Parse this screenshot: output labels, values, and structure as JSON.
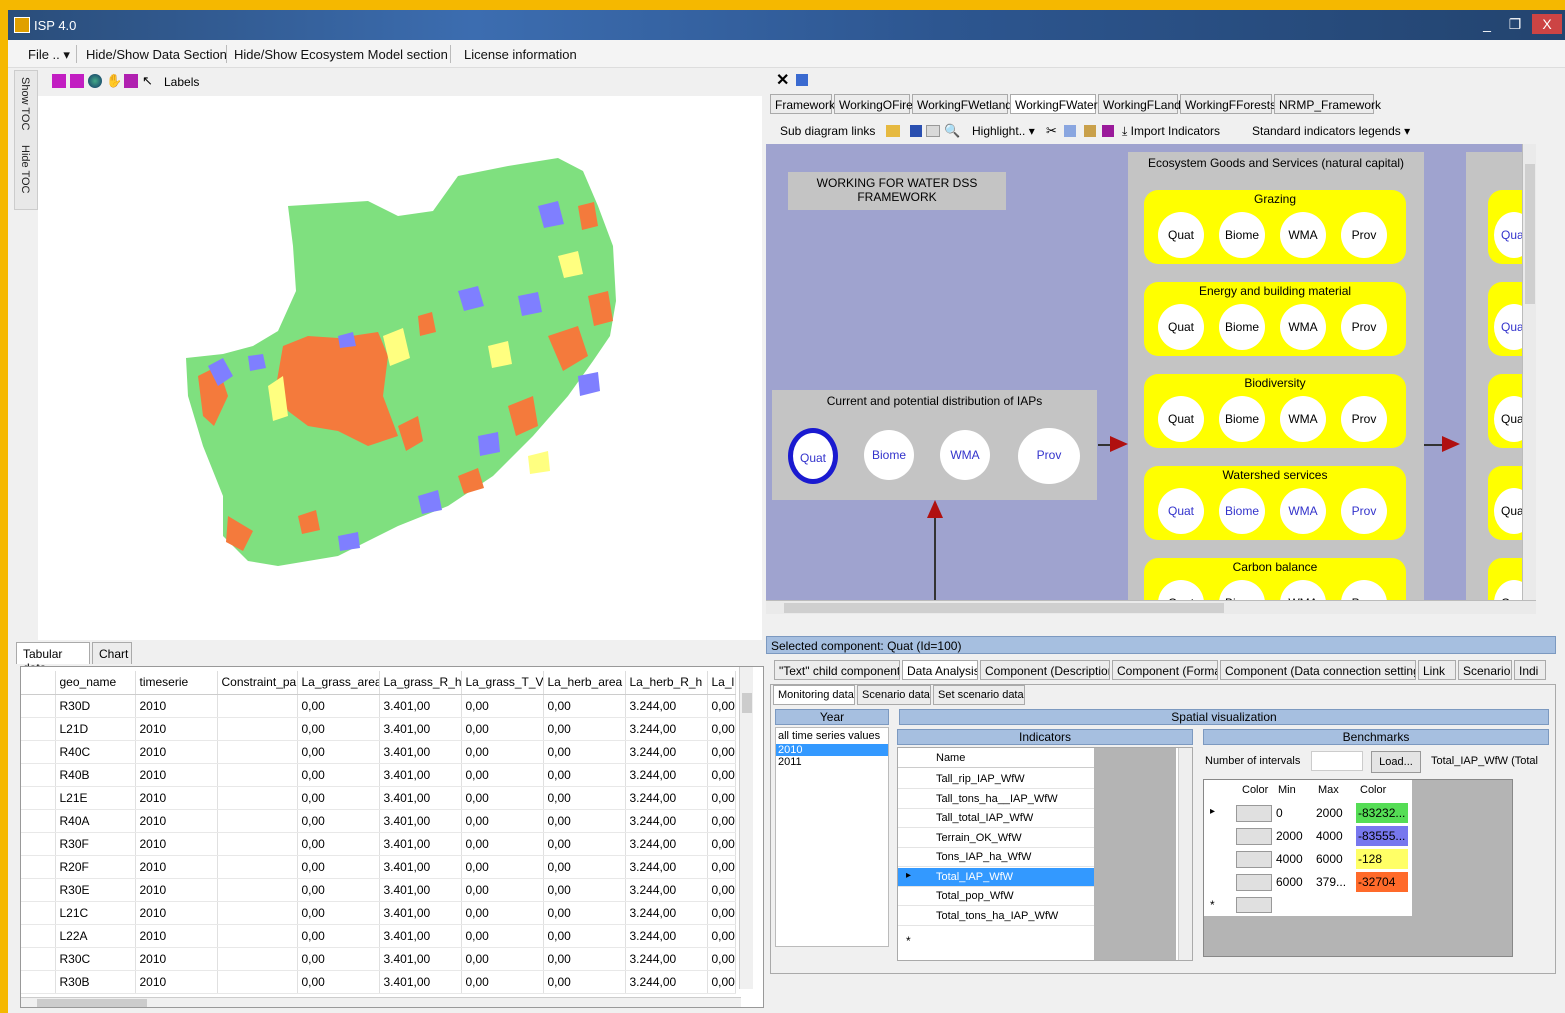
{
  "window": {
    "title": "ISP 4.0",
    "controls": {
      "minimize": "_",
      "maximize": "❐",
      "close": "X"
    }
  },
  "menu": {
    "file": "File ..",
    "hide_show_data": "Hide/Show Data Section",
    "hide_show_eco": "Hide/Show Ecosystem Model section",
    "license": "License information"
  },
  "left_strip": {
    "show_toc": "Show TOC",
    "hide_toc": "Hide TOC"
  },
  "map_toolbar": {
    "labels": "Labels"
  },
  "map": {
    "colors": {
      "background": "#7fe07f",
      "high": "#f47a3c",
      "medium": "#ffff80",
      "low": "#7f7fff"
    }
  },
  "left_tabs": {
    "tabular": "Tabular data",
    "chart": "Chart"
  },
  "table": {
    "columns": [
      "geo_name",
      "timeserie",
      "Constraint_pa",
      "La_grass_area",
      "La_grass_R_h",
      "La_grass_T_V",
      "La_herb_area",
      "La_herb_R_h",
      "La_l"
    ],
    "rows": [
      [
        "R30D",
        "2010",
        "",
        "0,00",
        "3.401,00",
        "0,00",
        "0,00",
        "3.244,00",
        "0,00"
      ],
      [
        "L21D",
        "2010",
        "",
        "0,00",
        "3.401,00",
        "0,00",
        "0,00",
        "3.244,00",
        "0,00"
      ],
      [
        "R40C",
        "2010",
        "",
        "0,00",
        "3.401,00",
        "0,00",
        "0,00",
        "3.244,00",
        "0,00"
      ],
      [
        "R40B",
        "2010",
        "",
        "0,00",
        "3.401,00",
        "0,00",
        "0,00",
        "3.244,00",
        "0,00"
      ],
      [
        "L21E",
        "2010",
        "",
        "0,00",
        "3.401,00",
        "0,00",
        "0,00",
        "3.244,00",
        "0,00"
      ],
      [
        "R40A",
        "2010",
        "",
        "0,00",
        "3.401,00",
        "0,00",
        "0,00",
        "3.244,00",
        "0,00"
      ],
      [
        "R30F",
        "2010",
        "",
        "0,00",
        "3.401,00",
        "0,00",
        "0,00",
        "3.244,00",
        "0,00"
      ],
      [
        "R20F",
        "2010",
        "",
        "0,00",
        "3.401,00",
        "0,00",
        "0,00",
        "3.244,00",
        "0,00"
      ],
      [
        "R30E",
        "2010",
        "",
        "0,00",
        "3.401,00",
        "0,00",
        "0,00",
        "3.244,00",
        "0,00"
      ],
      [
        "L21C",
        "2010",
        "",
        "0,00",
        "3.401,00",
        "0,00",
        "0,00",
        "3.244,00",
        "0,00"
      ],
      [
        "L22A",
        "2010",
        "",
        "0,00",
        "3.401,00",
        "0,00",
        "0,00",
        "3.244,00",
        "0,00"
      ],
      [
        "R30C",
        "2010",
        "",
        "0,00",
        "3.401,00",
        "0,00",
        "0,00",
        "3.244,00",
        "0,00"
      ],
      [
        "R30B",
        "2010",
        "",
        "0,00",
        "3.401,00",
        "0,00",
        "0,00",
        "3.244,00",
        "0,00"
      ]
    ]
  },
  "right_tabs": [
    "Framework",
    "WorkingOFire",
    "WorkingFWetland",
    "WorkingFWater",
    "WorkingFLand",
    "WorkingFForests",
    "NRMP_Framework"
  ],
  "right_tabs_active": "WorkingFWater",
  "diagram_toolbar": {
    "sub_links": "Sub diagram links",
    "highlight": "Highlight..",
    "import": "Import Indicators",
    "legends": "Standard indicators legends"
  },
  "diagram": {
    "title": "WORKING FOR WATER DSS FRAMEWORK",
    "ecosystem_header": "Ecosystem Goods and Services (natural capital)",
    "iap_box": "Current and potential distribution of IAPs",
    "circle_labels": {
      "quat": "Quat",
      "biome": "Biome",
      "wma": "WMA",
      "prov": "Prov"
    },
    "services": [
      "Grazing",
      "Energy and building material",
      "Biodiversity",
      "Watershed services",
      "Carbon balance"
    ]
  },
  "selected_component": "Selected component: Quat (Id=100)",
  "bottom_tabs": [
    "\"Text\" child components",
    "Data Analysis",
    "Component (Description)",
    "Component (Format)",
    "Component (Data connection settings)",
    "Link",
    "Scenario",
    "Indi"
  ],
  "bottom_tabs_active": "Data Analysis",
  "sub_tabs": [
    "Monitoring data",
    "Scenario data",
    "Set scenario data"
  ],
  "spatial": {
    "header": "Spatial visualization",
    "year_header": "Year",
    "years": [
      "all time series values",
      "2010",
      "2011"
    ],
    "indicators_header": "Indicators",
    "name_col": "Name",
    "indicators": [
      "Tall_rip_IAP_WfW",
      "Tall_tons_ha__IAP_WfW",
      "Tall_total_IAP_WfW",
      "Terrain_OK_WfW",
      "Tons_IAP_ha_WfW",
      "Total_IAP_WfW",
      "Total_pop_WfW",
      "Total_tons_ha_IAP_WfW"
    ],
    "selected_indicator": "Total_IAP_WfW",
    "benchmarks_header": "Benchmarks",
    "intervals_label": "Number of intervals",
    "load_button": "Load...",
    "bench_title": "Total_IAP_WfW (Total",
    "bench_cols": [
      "Color",
      "Min",
      "Max",
      "Color"
    ],
    "bench_rows": [
      {
        "min": "0",
        "max": "2000",
        "code": "-83232...",
        "color": "#55dd55"
      },
      {
        "min": "2000",
        "max": "4000",
        "code": "-83555...",
        "color": "#7777ee"
      },
      {
        "min": "4000",
        "max": "6000",
        "code": "-128",
        "color": "#ffff66"
      },
      {
        "min": "6000",
        "max": "379...",
        "code": "-32704",
        "color": "#ff6a2a"
      }
    ]
  }
}
